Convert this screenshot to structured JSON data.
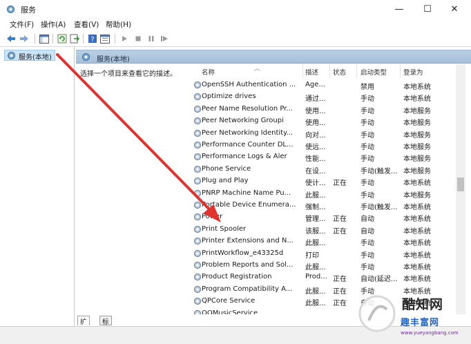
{
  "window": {
    "title": "服务",
    "minimize_glyph": "—",
    "maximize_glyph": "☐",
    "close_glyph": "✕"
  },
  "menu": [
    "文件(F)",
    "操作(A)",
    "查看(V)",
    "帮助(H)"
  ],
  "toolbar_icons": [
    "back-arrow-icon",
    "forward-arrow-icon",
    "show-hide-console-tree-icon",
    "refresh-icon",
    "export-list-icon",
    "help-icon",
    "properties-icon",
    "play-icon",
    "stop-icon",
    "pause-icon",
    "restart-icon"
  ],
  "tree": {
    "selected_label": "服务(本地)"
  },
  "pane": {
    "header": "服务(本地)",
    "description_hint": "选择一个项目来查看它的描述。"
  },
  "columns": {
    "name": "名称",
    "description": "描述",
    "status": "状态",
    "startup_type": "启动类型",
    "logon_as": "登录为"
  },
  "services": [
    {
      "name": "OpenSSH Authentication ...",
      "desc": "Age...",
      "status": "",
      "startup": "禁用",
      "logon": "本地系统"
    },
    {
      "name": "Optimize drives",
      "desc": "通过...",
      "status": "",
      "startup": "手动",
      "logon": "本地系统"
    },
    {
      "name": "Peer Name Resolution Pr...",
      "desc": "使用...",
      "status": "",
      "startup": "手动",
      "logon": "本地服务"
    },
    {
      "name": "Peer Networking Groupi",
      "desc": "使用...",
      "status": "",
      "startup": "手动",
      "logon": "本地服务"
    },
    {
      "name": "Peer Networking Identity...",
      "desc": "向对...",
      "status": "",
      "startup": "手动",
      "logon": "本地服务"
    },
    {
      "name": "Performance Counter DL...",
      "desc": "使远...",
      "status": "",
      "startup": "手动",
      "logon": "本地服务"
    },
    {
      "name": "Performance Logs & Aler",
      "desc": "性能...",
      "status": "",
      "startup": "手动",
      "logon": "本地服务"
    },
    {
      "name": "Phone Service",
      "desc": "在设...",
      "status": "",
      "startup": "手动(触发...",
      "logon": "本地服务"
    },
    {
      "name": "Plug and Play",
      "desc": "使计...",
      "status": "正在",
      "startup": "手动",
      "logon": "本地系统"
    },
    {
      "name": "PNRP Machine Name Pu...",
      "desc": "此服...",
      "status": "",
      "startup": "手动",
      "logon": "本地服务"
    },
    {
      "name": "Portable Device Enumera...",
      "desc": "强制...",
      "status": "",
      "startup": "手动(触发...",
      "logon": "本地系统"
    },
    {
      "name": "Power",
      "desc": "管理...",
      "status": "正在",
      "startup": "自动",
      "logon": "本地系统"
    },
    {
      "name": "Print Spooler",
      "desc": "该服...",
      "status": "正在",
      "startup": "自动",
      "logon": "本地系统"
    },
    {
      "name": "Printer Extensions and N...",
      "desc": "此服...",
      "status": "",
      "startup": "手动",
      "logon": "本地系统"
    },
    {
      "name": "PrintWorkflow_e43325d",
      "desc": "打印",
      "status": "",
      "startup": "手动",
      "logon": "本地系统"
    },
    {
      "name": "Problem Reports and Sol...",
      "desc": "此服...",
      "status": "",
      "startup": "手动",
      "logon": "本地系统"
    },
    {
      "name": "Product Registration",
      "desc": "Prod...",
      "status": "正在",
      "startup": "自动(延迟...",
      "logon": "本地系统"
    },
    {
      "name": "Program Compatibility A...",
      "desc": "此服...",
      "status": "正在",
      "startup": "手动",
      "logon": "本地系统"
    },
    {
      "name": "QPCore Service",
      "desc": "此服...",
      "status": "正在",
      "startup": "自动",
      "logon": "本地系统"
    },
    {
      "name": "QQMusicService",
      "desc": "",
      "status": "",
      "startup": "",
      "logon": ""
    }
  ],
  "tabs": {
    "extended": "扩展",
    "standard": "标准"
  },
  "watermark": {
    "line1": "酷知网",
    "line2": "趣丰富网",
    "line3": "www.yueyangbang.com"
  },
  "colors": {
    "arrow": "#e0322e",
    "selection": "#cce4f7",
    "header_band": "#b0c8de"
  }
}
